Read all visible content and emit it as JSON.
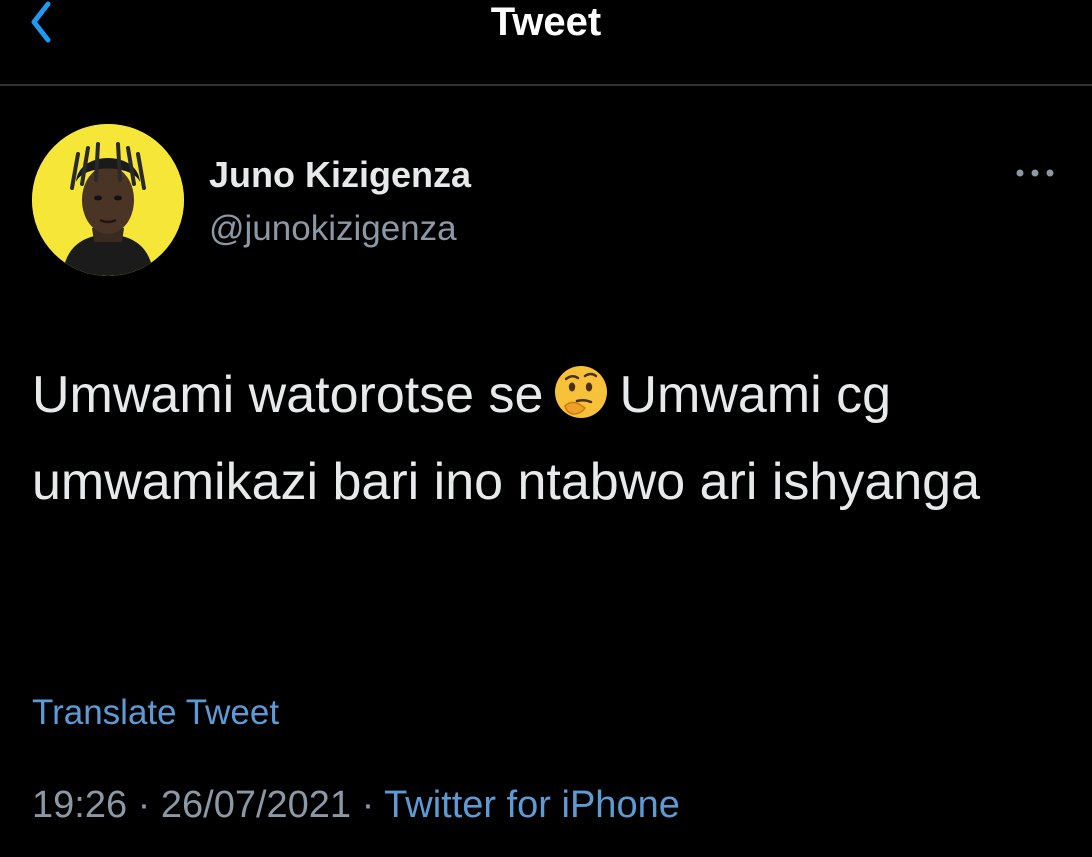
{
  "header": {
    "title": "Tweet",
    "back_icon": "chevron-left-icon",
    "accent_color": "#1d9bf0"
  },
  "author": {
    "display_name": "Juno Kizigenza",
    "handle": "@junokizigenza",
    "avatar_background": "#f5e637"
  },
  "tweet": {
    "text_part1": "Umwami watorotse se",
    "emoji": "thinking-face-emoji",
    "text_part2": "Umwami cg umwamikazi bari ino ntabwo ari ishyanga",
    "translate_label": "Translate Tweet"
  },
  "meta": {
    "time": "19:26",
    "separator": "·",
    "date": "26/07/2021",
    "source": "Twitter for iPhone"
  }
}
